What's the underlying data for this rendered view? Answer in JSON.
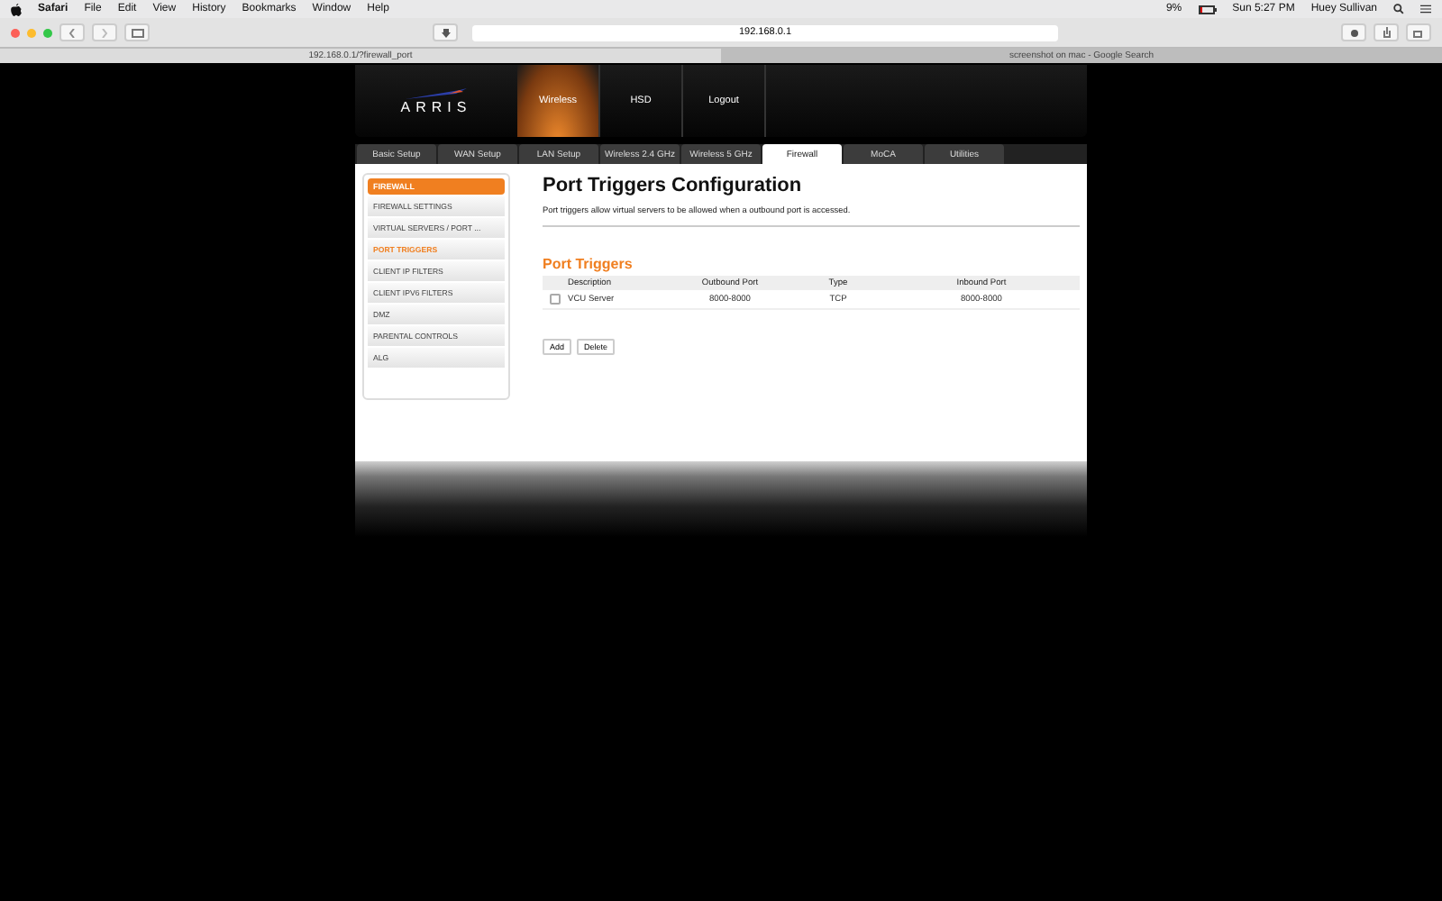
{
  "menubar": {
    "app": "Safari",
    "menus": [
      "File",
      "Edit",
      "View",
      "History",
      "Bookmarks",
      "Window",
      "Help"
    ],
    "battery": "9%",
    "time": "Sun 5:27 PM",
    "user": "Huey Sullivan"
  },
  "toolbar": {
    "address": "192.168.0.1"
  },
  "browser_tabs": [
    {
      "title": "192.168.0.1/?firewall_port",
      "selected": true
    },
    {
      "title": "screenshot on mac - Google Search",
      "selected": false
    }
  ],
  "router": {
    "logo": "ARRIS",
    "top_nav": [
      {
        "label": "Wireless",
        "selected": true
      },
      {
        "label": "HSD",
        "selected": false
      },
      {
        "label": "Logout",
        "selected": false
      }
    ],
    "tabs": [
      {
        "label": "Basic Setup",
        "selected": false
      },
      {
        "label": "WAN Setup",
        "selected": false
      },
      {
        "label": "LAN Setup",
        "selected": false
      },
      {
        "label": "Wireless 2.4 GHz",
        "selected": false
      },
      {
        "label": "Wireless 5 GHz",
        "selected": false
      },
      {
        "label": "Firewall",
        "selected": true
      },
      {
        "label": "MoCA",
        "selected": false
      },
      {
        "label": "Utilities",
        "selected": false
      }
    ],
    "sidebar": {
      "heading": "FIREWALL",
      "items": [
        {
          "label": "FIREWALL SETTINGS",
          "selected": false
        },
        {
          "label": "VIRTUAL SERVERS / PORT ...",
          "selected": false
        },
        {
          "label": "PORT TRIGGERS",
          "selected": true
        },
        {
          "label": "CLIENT IP FILTERS",
          "selected": false
        },
        {
          "label": "CLIENT IPV6 FILTERS",
          "selected": false
        },
        {
          "label": "DMZ",
          "selected": false
        },
        {
          "label": "PARENTAL CONTROLS",
          "selected": false
        },
        {
          "label": "ALG",
          "selected": false
        }
      ]
    },
    "title": "Port Triggers Configuration",
    "description": "Port triggers allow virtual servers to be allowed when a outbound port is accessed.",
    "section_title": "Port Triggers",
    "table": {
      "columns": [
        "Description",
        "Outbound Port",
        "Type",
        "Inbound Port"
      ],
      "rows": [
        {
          "checked": false,
          "cells": [
            "VCU Server",
            "8000-8000",
            "TCP",
            "8000-8000"
          ]
        }
      ]
    },
    "buttons": [
      "Add",
      "Delete"
    ]
  }
}
